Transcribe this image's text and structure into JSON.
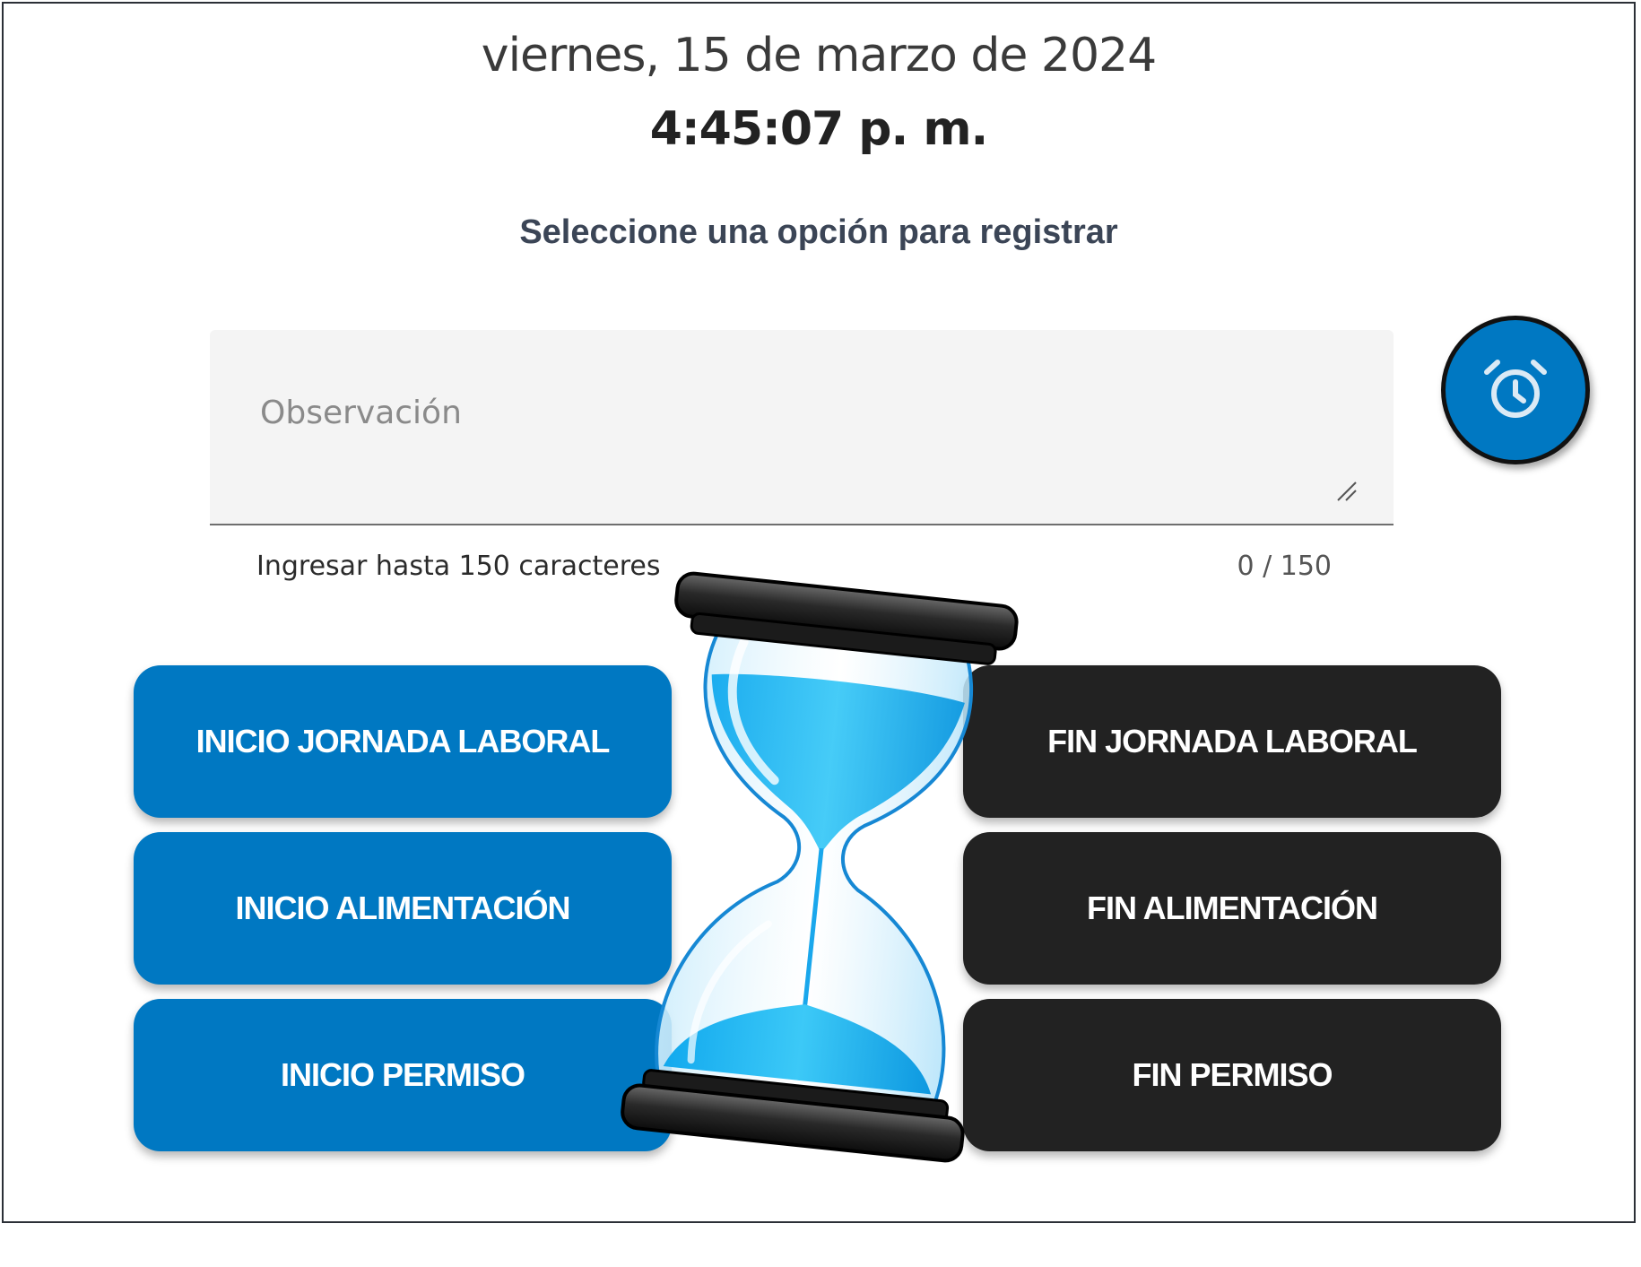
{
  "header": {
    "date": "viernes, 15 de marzo de 2024",
    "time": "4:45:07 p. m.",
    "instruction": "Seleccione una opción para registrar"
  },
  "observation": {
    "placeholder": "Observación",
    "value": "",
    "hint": "Ingresar hasta 150 caracteres",
    "counter": "0 / 150"
  },
  "clock_button": {
    "icon": "alarm-clock-icon"
  },
  "actions": {
    "start_workday": "INICIO JORNADA LABORAL",
    "end_workday": "FIN JORNADA LABORAL",
    "start_meal": "INICIO ALIMENTACIÓN",
    "end_meal": "FIN ALIMENTACIÓN",
    "start_permit": "INICIO PERMISO",
    "end_permit": "FIN PERMISO"
  },
  "overlay": {
    "icon": "hourglass-icon"
  },
  "colors": {
    "primary": "#0078c2",
    "dark": "#222222"
  }
}
